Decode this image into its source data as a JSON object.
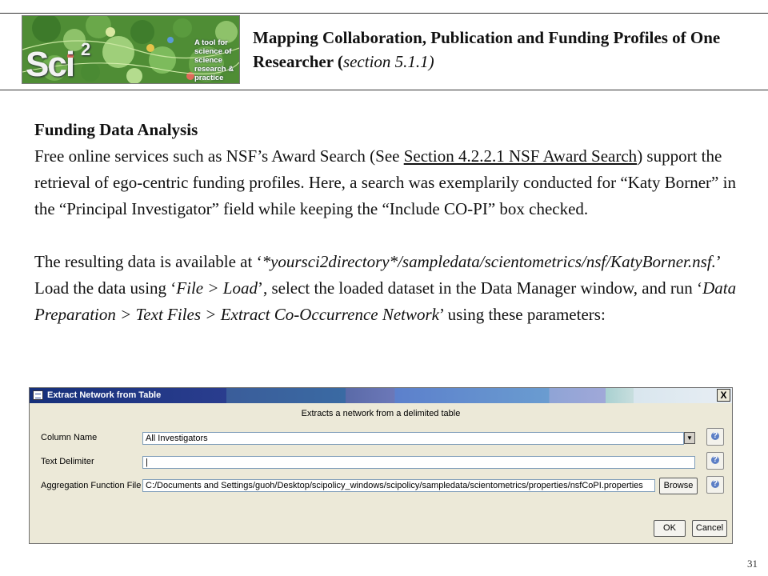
{
  "header": {
    "logo": {
      "text": "A tool for science of science research & practice",
      "wordmark": "Sci",
      "wordmark_sup": "2"
    },
    "title_part1": "Mapping Collaboration, Publication and Funding Profiles of One Researcher (",
    "title_section": "section 5.1.1)"
  },
  "body": {
    "heading": "Funding Data Analysis",
    "p1_a": "Free online services such as NSF’s Award Search (See ",
    "p1_link": "Section 4.2.2.1 NSF Award Search",
    "p1_b": ") support the retrieval of ego-centric funding profiles. Here, a search was exemplarily conducted for “Katy Borner” in the “Principal Investigator” field while keeping the “Include CO-PI” box checked.",
    "p2_a": "The resulting data is available at ‘",
    "p2_path": "*yoursci2directory*/sampledata/scientometrics/nsf/KatyBorner.nsf.",
    "p2_b": "’ Load the data using ‘",
    "p2_load": "File > Load",
    "p2_c": "’, select the loaded dataset in the Data Manager window, and run ‘",
    "p2_menu": "Data Preparation > Text Files > Extract Co-Occurrence Network",
    "p2_d": "’ using these parameters:"
  },
  "dialog": {
    "title": "Extract Network from Table",
    "close_label": "X",
    "description": "Extracts a network from a delimited table",
    "column_name_label": "Column Name",
    "column_name_value": "All Investigators",
    "text_delimiter_label": "Text Delimiter",
    "text_delimiter_value": "|",
    "agg_label": "Aggregation Function File",
    "agg_value": "C:/Documents and Settings/guoh/Desktop/scipolicy_windows/scipolicy/sampledata/scientometrics/properties/nsfCoPI.properties",
    "browse_label": "Browse",
    "ok_label": "OK",
    "cancel_label": "Cancel",
    "icons": {
      "app": "table-icon",
      "dropdown": "chevron-down-icon",
      "help": "help-icon"
    }
  },
  "footer": {
    "page_number": "31"
  }
}
